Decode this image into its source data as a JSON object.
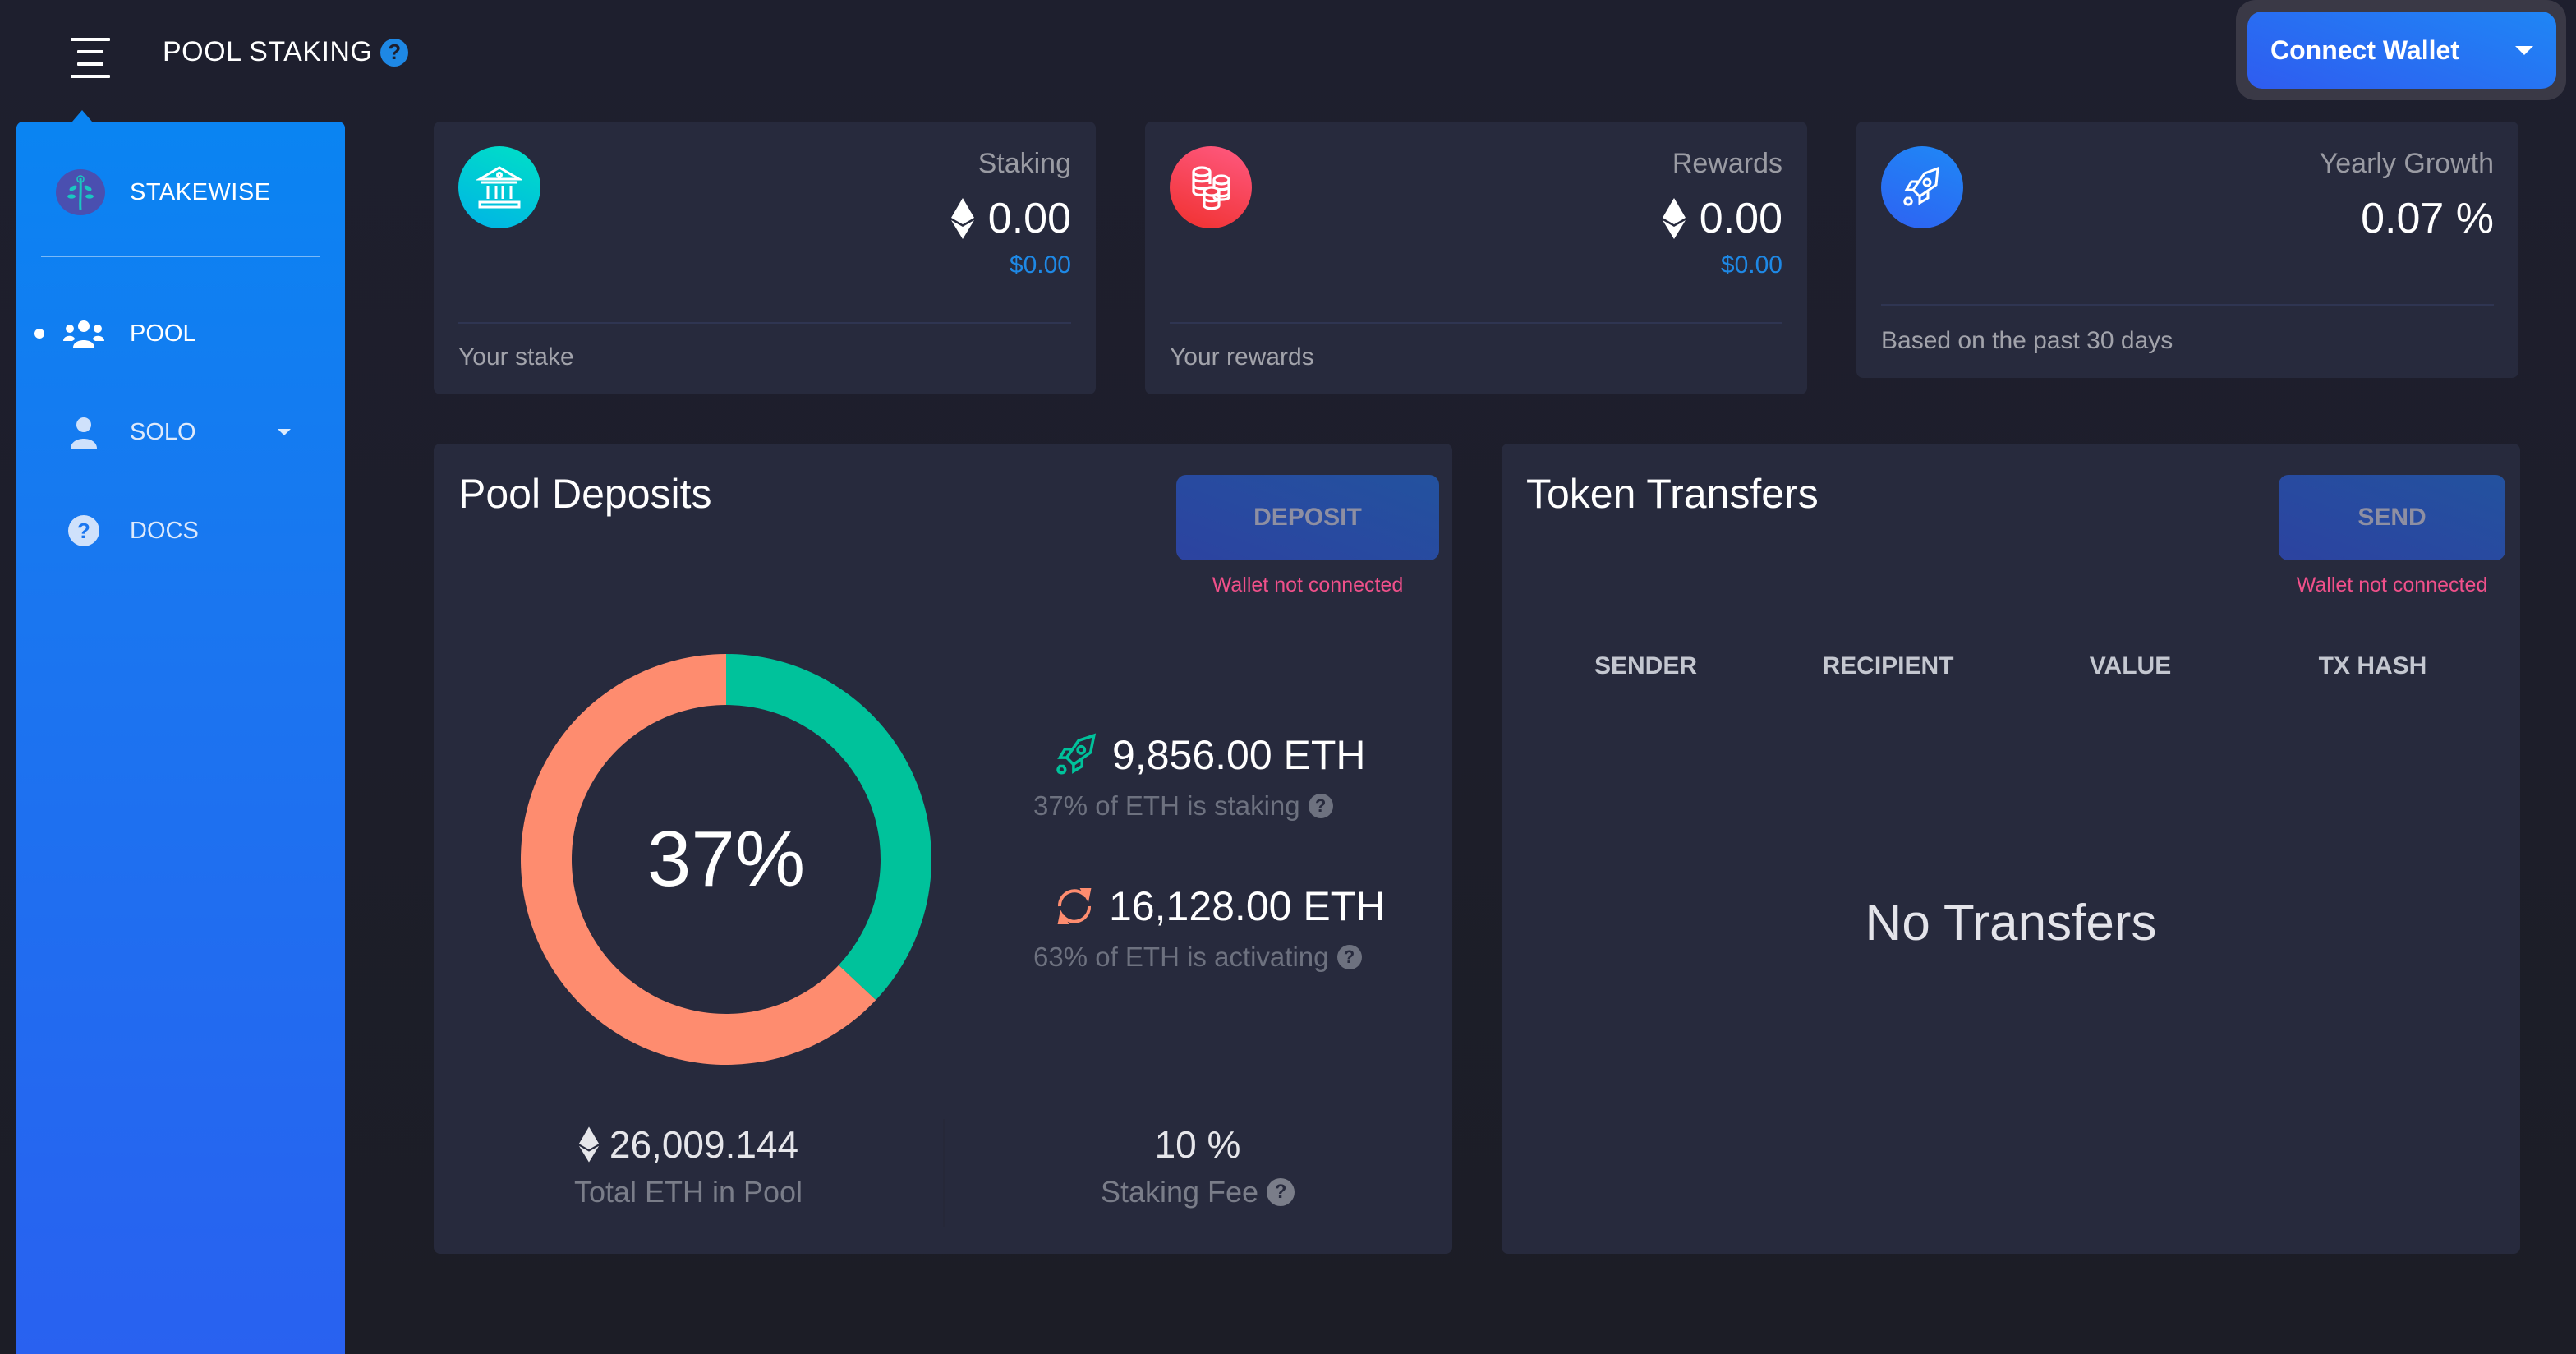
{
  "header": {
    "title": "POOL STAKING",
    "help_glyph": "?",
    "menu_icon": "hamburger-icon",
    "connect_wallet_label": "Connect Wallet"
  },
  "sidebar": {
    "brand": {
      "name": "STAKEWISE",
      "logo": "stakewise-tree-logo"
    },
    "items": [
      {
        "label": "POOL",
        "icon": "users-icon",
        "active": true
      },
      {
        "label": "SOLO",
        "icon": "user-icon",
        "has_submenu": true
      },
      {
        "label": "DOCS",
        "icon": "question-circle-icon"
      }
    ]
  },
  "stats": [
    {
      "label": "Staking",
      "value": "0.00",
      "currency_icon": "eth-icon",
      "usd": "$0.00",
      "footer": "Your stake",
      "icon": "bank-icon",
      "color": "#00c2d6"
    },
    {
      "label": "Rewards",
      "value": "0.00",
      "currency_icon": "eth-icon",
      "usd": "$0.00",
      "footer": "Your rewards",
      "icon": "coins-icon",
      "color": "#f03c4a"
    },
    {
      "label": "Yearly Growth",
      "value": "0.07 %",
      "footer": "Based on the past 30 days",
      "icon": "rocket-icon",
      "color": "#2a7af2"
    }
  ],
  "pool_deposits": {
    "title": "Pool Deposits",
    "button_label": "DEPOSIT",
    "warning": "Wallet not connected",
    "center_label": "37%",
    "staking": {
      "amount": "9,856.00 ETH",
      "caption": "37% of ETH is staking",
      "icon": "rocket-icon",
      "color": "#00c29b"
    },
    "activating": {
      "amount": "16,128.00 ETH",
      "caption": "63% of ETH is activating",
      "icon": "sync-icon",
      "color": "#fe8c6f"
    },
    "total": {
      "value": "26,009.144",
      "label": "Total ETH in Pool"
    },
    "fee": {
      "value": "10 %",
      "label": "Staking Fee"
    }
  },
  "chart_data": {
    "type": "pie",
    "title": "",
    "categories": [
      "Staking",
      "Activating"
    ],
    "values": [
      37,
      63
    ],
    "units": "%",
    "colors": [
      "#00c29b",
      "#fe8c6f"
    ],
    "center_text": "37%",
    "donut": true
  },
  "token_transfers": {
    "title": "Token Transfers",
    "button_label": "SEND",
    "warning": "Wallet not connected",
    "columns": [
      "SENDER",
      "RECIPIENT",
      "VALUE",
      "TX HASH"
    ],
    "rows": [],
    "empty_text": "No Transfers"
  }
}
